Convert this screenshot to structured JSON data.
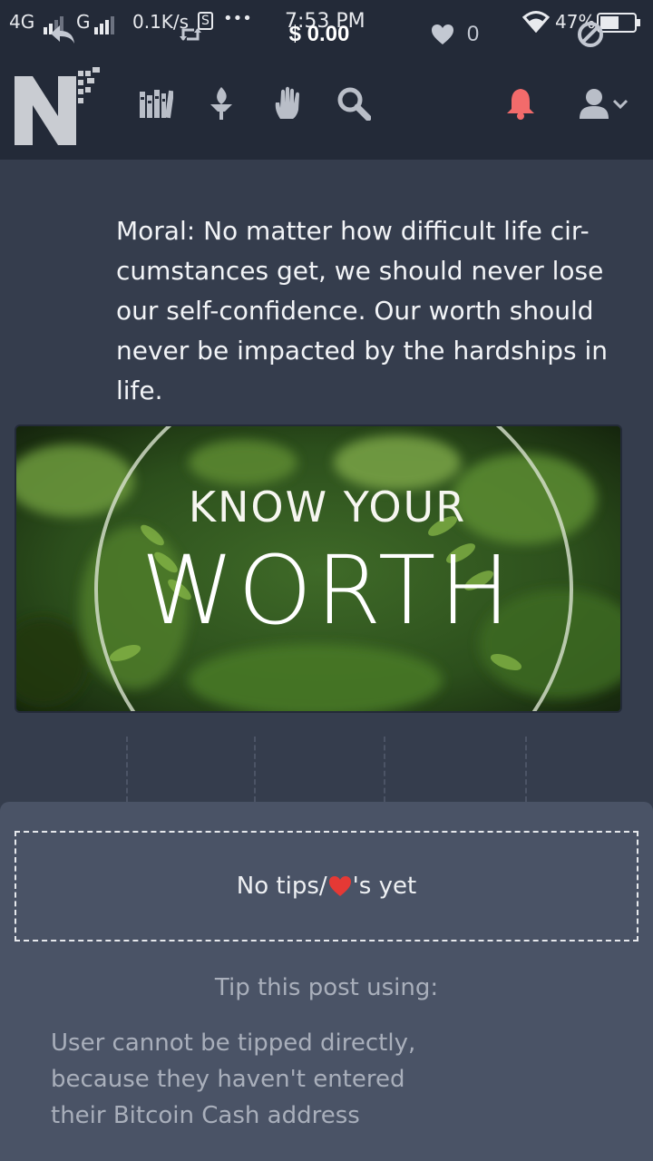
{
  "status_bar": {
    "network1": "4G",
    "network2": "G",
    "speed": "0.1K/s",
    "s_badge": "S",
    "dots": "•••",
    "time": "7:53 PM",
    "battery": "47%"
  },
  "header": {
    "logo_icon": "noise-cash-logo",
    "nav_icons": [
      "library-icon",
      "torch-icon",
      "hand-icon",
      "search-icon"
    ],
    "bell_color": "#f26b6b",
    "user_icon": "user-icon"
  },
  "post": {
    "moral_text": "Moral: No matter how difficult life cir-\ncumstances get, we should never lose\nour self-confidence. Our worth should\nnever be impacted by the hardships in\nlife.",
    "image": {
      "line1": "KNOW YOUR",
      "line2": "WORTH"
    }
  },
  "actions": {
    "amount": "$ 0.00",
    "likes": "0"
  },
  "tips": {
    "no_tips_prefix": "No tips/",
    "no_tips_suffix": "'s yet",
    "tip_using": "Tip this post using:",
    "cannot_tip": "User cannot be tipped directly,\nbecause they haven't entered\ntheir Bitcoin Cash address"
  },
  "colors": {
    "header_bg": "#232a38",
    "content_bg": "#353d4d",
    "panel_bg": "#4a5366",
    "heart": "#e53935"
  }
}
